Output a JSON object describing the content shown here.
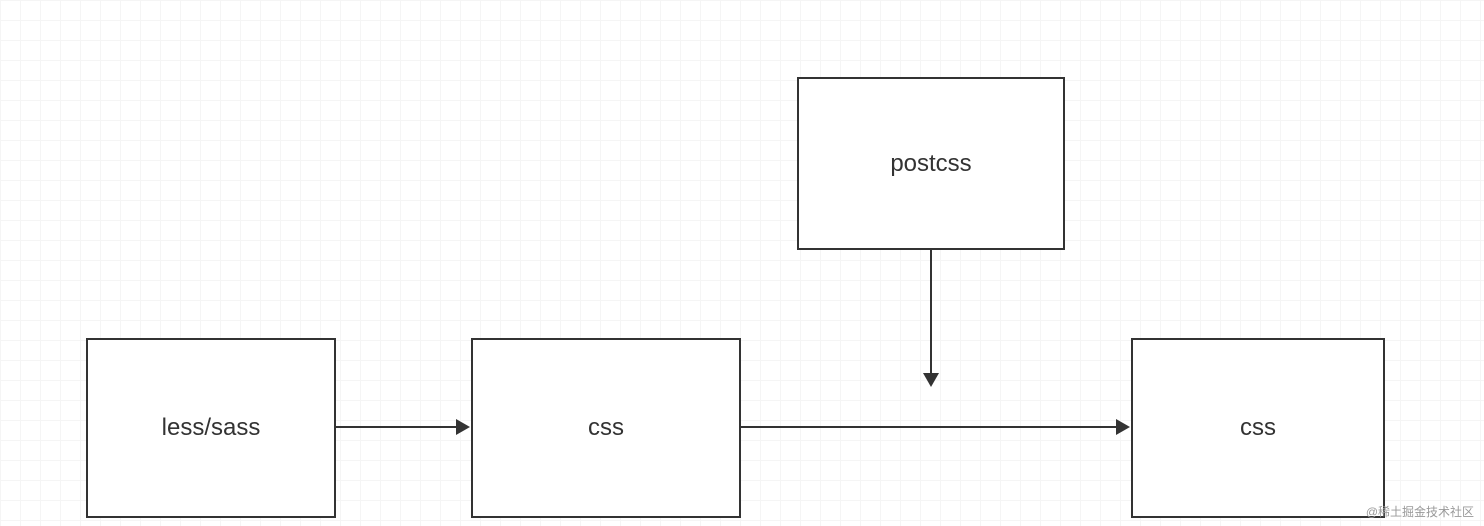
{
  "nodes": {
    "less_sass": "less/sass",
    "css_mid": "css",
    "postcss": "postcss",
    "css_end": "css"
  },
  "watermark": "@稀土掘金技术社区"
}
